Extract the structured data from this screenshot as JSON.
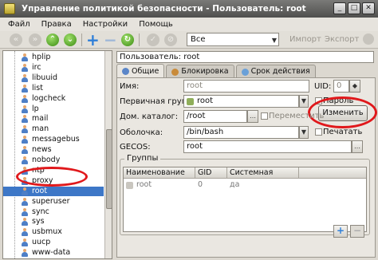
{
  "window": {
    "title": "Управление политикой безопасности - Пользователь: root"
  },
  "menu": {
    "items": [
      "Файл",
      "Правка",
      "Настройки",
      "Помощь"
    ]
  },
  "toolbar": {
    "filter_value": "Все",
    "import_label": "Импорт",
    "export_label": "Экспорт"
  },
  "tree": {
    "items": [
      "hplip",
      "irc",
      "libuuid",
      "list",
      "logcheck",
      "lp",
      "mail",
      "man",
      "messagebus",
      "news",
      "nobody",
      "ntp",
      "proxy",
      "root",
      "superuser",
      "sync",
      "sys",
      "usbmux",
      "uucp",
      "www-data"
    ],
    "selected": "root"
  },
  "user_header": "Пользователь: root",
  "tabs": [
    "Общие",
    "Блокировка",
    "Срок действия"
  ],
  "form": {
    "name_label": "Имя:",
    "name_value": "root",
    "uid_label": "UID:",
    "uid_value": "0",
    "primary_group_label": "Первичная группа:",
    "primary_group_value": "root",
    "password_label": "Пароль",
    "change_button": "Изменить",
    "home_label": "Дом. каталог:",
    "home_value": "/root",
    "move_label": "Переместить",
    "shell_label": "Оболочка:",
    "shell_value": "/bin/bash",
    "print_label": "Печатать",
    "gecos_label": "GECOS:",
    "gecos_value": "root"
  },
  "groups": {
    "title": "Группы",
    "columns": [
      "Наименование",
      "GID",
      "Системная"
    ],
    "rows": [
      {
        "name": "root",
        "gid": "0",
        "system": "да"
      }
    ]
  },
  "colors": {
    "selection": "#3d77c7",
    "annotation": "#e0181b"
  }
}
